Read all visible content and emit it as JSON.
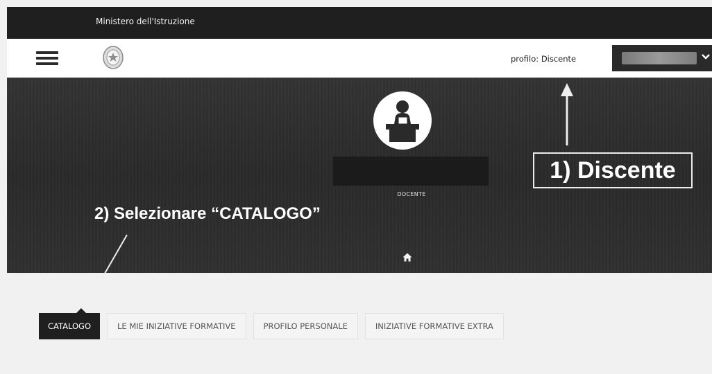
{
  "header": {
    "ministry_title": "Ministero dell'Istruzione",
    "profile_label": "profilo: Discente"
  },
  "hero": {
    "role": "DOCENTE"
  },
  "annotations": {
    "step1": "1) Discente",
    "step2": "2) Selezionare “CATALOGO”"
  },
  "tabs": [
    {
      "label": "CATALOGO",
      "active": true
    },
    {
      "label": "LE MIE INIZIATIVE FORMATIVE",
      "active": false
    },
    {
      "label": "PROFILO PERSONALE",
      "active": false
    },
    {
      "label": "INIZIATIVE FORMATIVE EXTRA",
      "active": false
    }
  ],
  "icons": {
    "menu": "hamburger-menu-icon",
    "emblem": "italian-republic-emblem-icon",
    "dropdown": "chevron-down-icon",
    "avatar": "teacher-desk-icon",
    "home": "home-icon"
  },
  "colors": {
    "topbar": "#1f1f1f",
    "hero": "#2d2d2d",
    "active_tab": "#1f1f1f",
    "page_background": "#f1f1f1"
  }
}
